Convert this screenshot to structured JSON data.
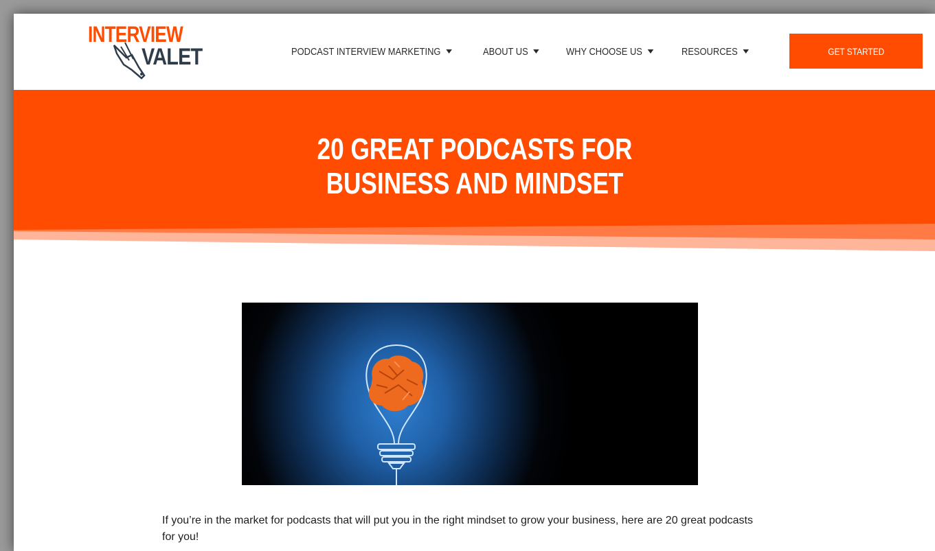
{
  "brand": {
    "logo_line1": "INTERVIEW",
    "logo_line2": "VALET",
    "primary_color": "#ff4c00",
    "dark_color": "#2f3d4a"
  },
  "nav": {
    "items": [
      {
        "label": "PODCAST INTERVIEW MARKETING",
        "icon": "caret-down-icon"
      },
      {
        "label": "ABOUT US",
        "icon": "caret-down-icon"
      },
      {
        "label": "WHY CHOOSE US",
        "icon": "caret-down-icon"
      },
      {
        "label": "RESOURCES",
        "icon": "caret-down-icon"
      }
    ],
    "cta_label": "GET STARTED"
  },
  "hero": {
    "title": "20 GREAT PODCASTS FOR BUSINESS AND MINDSET",
    "background": "#ff4c00"
  },
  "article": {
    "featured_image": "light-bulb-crumpled-paper-image",
    "intro": "If you’re in the market for podcasts that will put you in the right mindset to grow your business, here are 20 great podcasts for you!"
  }
}
